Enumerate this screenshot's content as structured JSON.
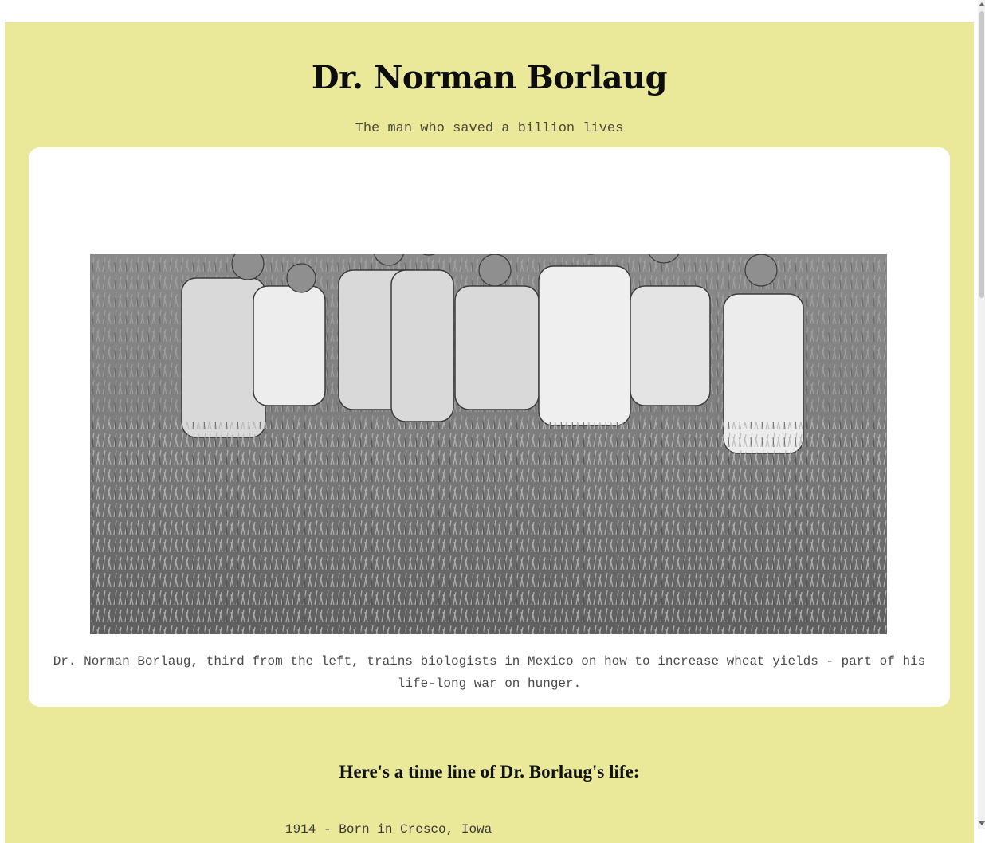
{
  "header": {
    "title": "Dr. Norman Borlaug",
    "subtitle": "The man who saved a billion lives"
  },
  "figure": {
    "image_alt_icon": "wheat-field-photo",
    "caption": "Dr. Norman Borlaug, third from the left, trains biologists in Mexico on how to increase wheat yields - part of his life-long war on hunger."
  },
  "timeline": {
    "heading": "Here's a time line of Dr. Borlaug's life:",
    "first_item": "1914 - Born in Cresco, Iowa"
  },
  "colors": {
    "page_background": "#eae99a",
    "card_background": "#ffffff"
  }
}
